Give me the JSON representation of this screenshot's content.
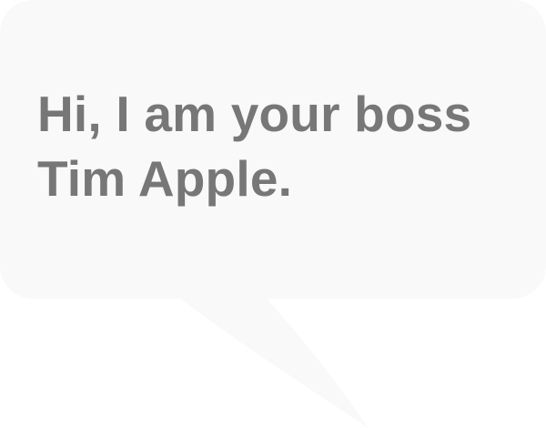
{
  "speech_bubble": {
    "lines": [
      "Hi, I am your boss",
      "Tim Apple."
    ],
    "background_color": "#f9f9f9",
    "text_color": "#777777"
  }
}
